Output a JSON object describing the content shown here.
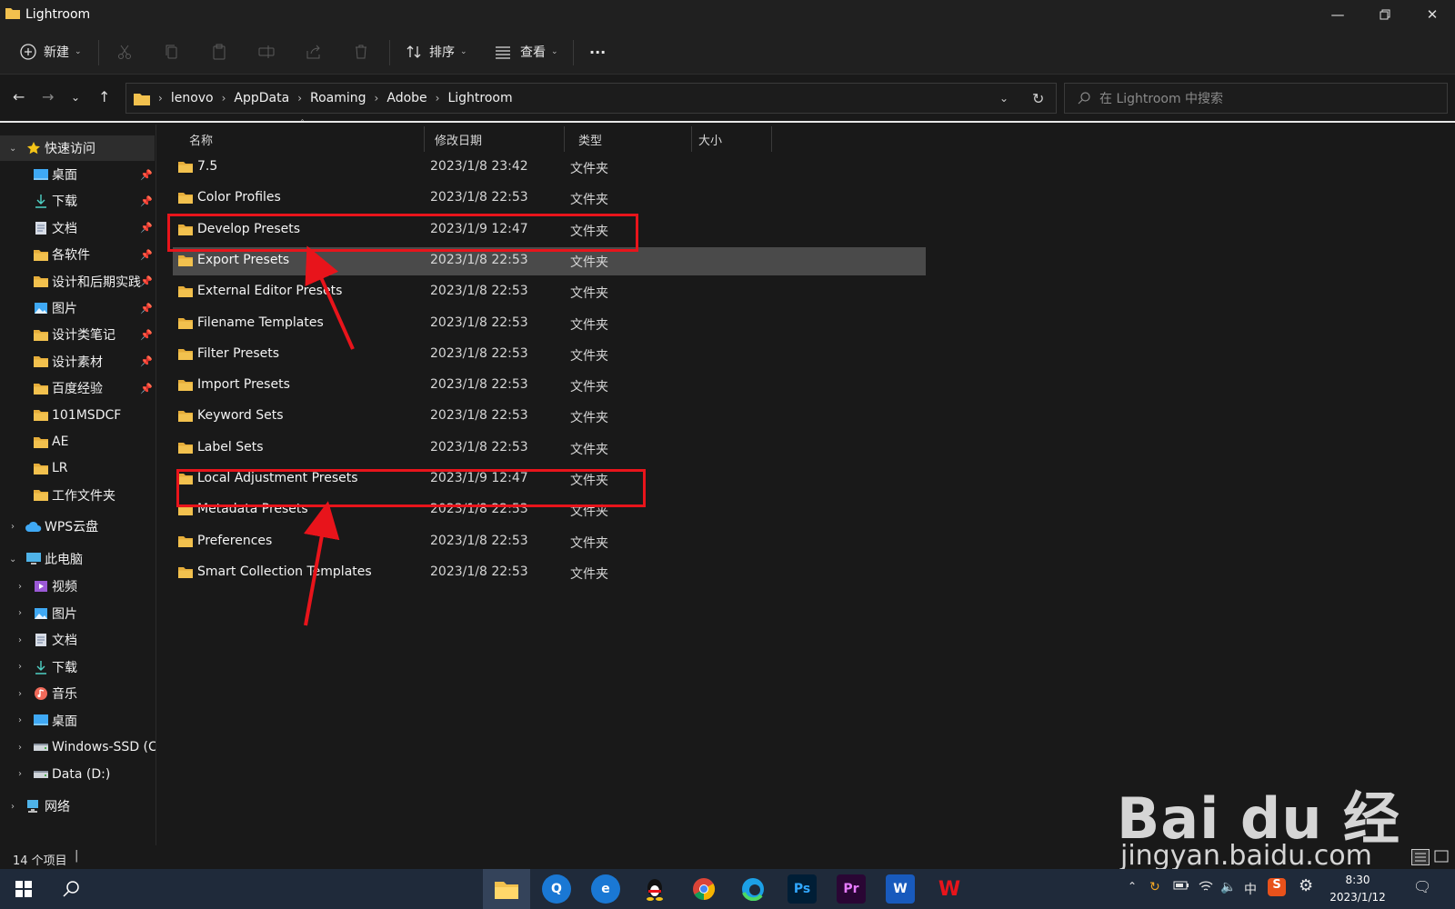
{
  "window": {
    "title": "Lightroom"
  },
  "toolbar": {
    "new_label": "新建",
    "sort_label": "排序",
    "view_label": "查看",
    "more_label": "···"
  },
  "address": {
    "crumbs": [
      "lenovo",
      "AppData",
      "Roaming",
      "Adobe",
      "Lightroom"
    ]
  },
  "search": {
    "placeholder": "在 Lightroom 中搜索"
  },
  "sidebar": {
    "quick_access": "快速访问",
    "quick_items": [
      {
        "label": "桌面",
        "icon": "desktop-icon",
        "pinned": true
      },
      {
        "label": "下载",
        "icon": "download-icon",
        "pinned": true
      },
      {
        "label": "文档",
        "icon": "document-icon",
        "pinned": true
      },
      {
        "label": "各软件",
        "icon": "folder-icon",
        "pinned": true
      },
      {
        "label": "设计和后期实践",
        "icon": "folder-icon",
        "pinned": true
      },
      {
        "label": "图片",
        "icon": "pictures-icon",
        "pinned": true
      },
      {
        "label": "设计类笔记",
        "icon": "folder-icon",
        "pinned": true
      },
      {
        "label": "设计素材",
        "icon": "folder-icon",
        "pinned": true
      },
      {
        "label": "百度经验",
        "icon": "folder-icon",
        "pinned": true
      },
      {
        "label": "101MSDCF",
        "icon": "folder-icon",
        "pinned": false
      },
      {
        "label": "AE",
        "icon": "folder-icon",
        "pinned": false
      },
      {
        "label": "LR",
        "icon": "folder-icon",
        "pinned": false
      },
      {
        "label": "工作文件夹",
        "icon": "folder-icon",
        "pinned": false
      }
    ],
    "wps": "WPS云盘",
    "this_pc": "此电脑",
    "pc_items": [
      {
        "label": "视频",
        "icon": "video-icon"
      },
      {
        "label": "图片",
        "icon": "pictures-icon"
      },
      {
        "label": "文档",
        "icon": "document-icon"
      },
      {
        "label": "下载",
        "icon": "download-icon"
      },
      {
        "label": "音乐",
        "icon": "music-icon"
      },
      {
        "label": "桌面",
        "icon": "desktop-icon"
      },
      {
        "label": "Windows-SSD (C:)",
        "icon": "drive-icon"
      },
      {
        "label": "Data (D:)",
        "icon": "drive-icon"
      }
    ],
    "network": "网络"
  },
  "columns": {
    "name": "名称",
    "date": "修改日期",
    "type": "类型",
    "size": "大小"
  },
  "files": [
    {
      "name": "7.5",
      "date": "2023/1/8 23:42",
      "type": "文件夹"
    },
    {
      "name": "Color Profiles",
      "date": "2023/1/8 22:53",
      "type": "文件夹"
    },
    {
      "name": "Develop Presets",
      "date": "2023/1/9 12:47",
      "type": "文件夹"
    },
    {
      "name": "Export Presets",
      "date": "2023/1/8 22:53",
      "type": "文件夹"
    },
    {
      "name": "External Editor Presets",
      "date": "2023/1/8 22:53",
      "type": "文件夹"
    },
    {
      "name": "Filename Templates",
      "date": "2023/1/8 22:53",
      "type": "文件夹"
    },
    {
      "name": "Filter Presets",
      "date": "2023/1/8 22:53",
      "type": "文件夹"
    },
    {
      "name": "Import Presets",
      "date": "2023/1/8 22:53",
      "type": "文件夹"
    },
    {
      "name": "Keyword Sets",
      "date": "2023/1/8 22:53",
      "type": "文件夹"
    },
    {
      "name": "Label Sets",
      "date": "2023/1/8 22:53",
      "type": "文件夹"
    },
    {
      "name": "Local Adjustment Presets",
      "date": "2023/1/9 12:47",
      "type": "文件夹"
    },
    {
      "name": "Metadata Presets",
      "date": "2023/1/8 22:53",
      "type": "文件夹"
    },
    {
      "name": "Preferences",
      "date": "2023/1/8 22:53",
      "type": "文件夹"
    },
    {
      "name": "Smart Collection Templates",
      "date": "2023/1/8 22:53",
      "type": "文件夹"
    }
  ],
  "status": {
    "count": "14 个项目"
  },
  "taskbar": {
    "ime": "中",
    "time": "8:30",
    "date": "2023/1/12"
  },
  "watermark": {
    "logo": "Bai  du 经验",
    "url": "jingyan.baidu.com"
  },
  "colors": {
    "accent": "#e8141b",
    "folder": "#f2c14e",
    "taskbar": "#1f2a3a"
  }
}
